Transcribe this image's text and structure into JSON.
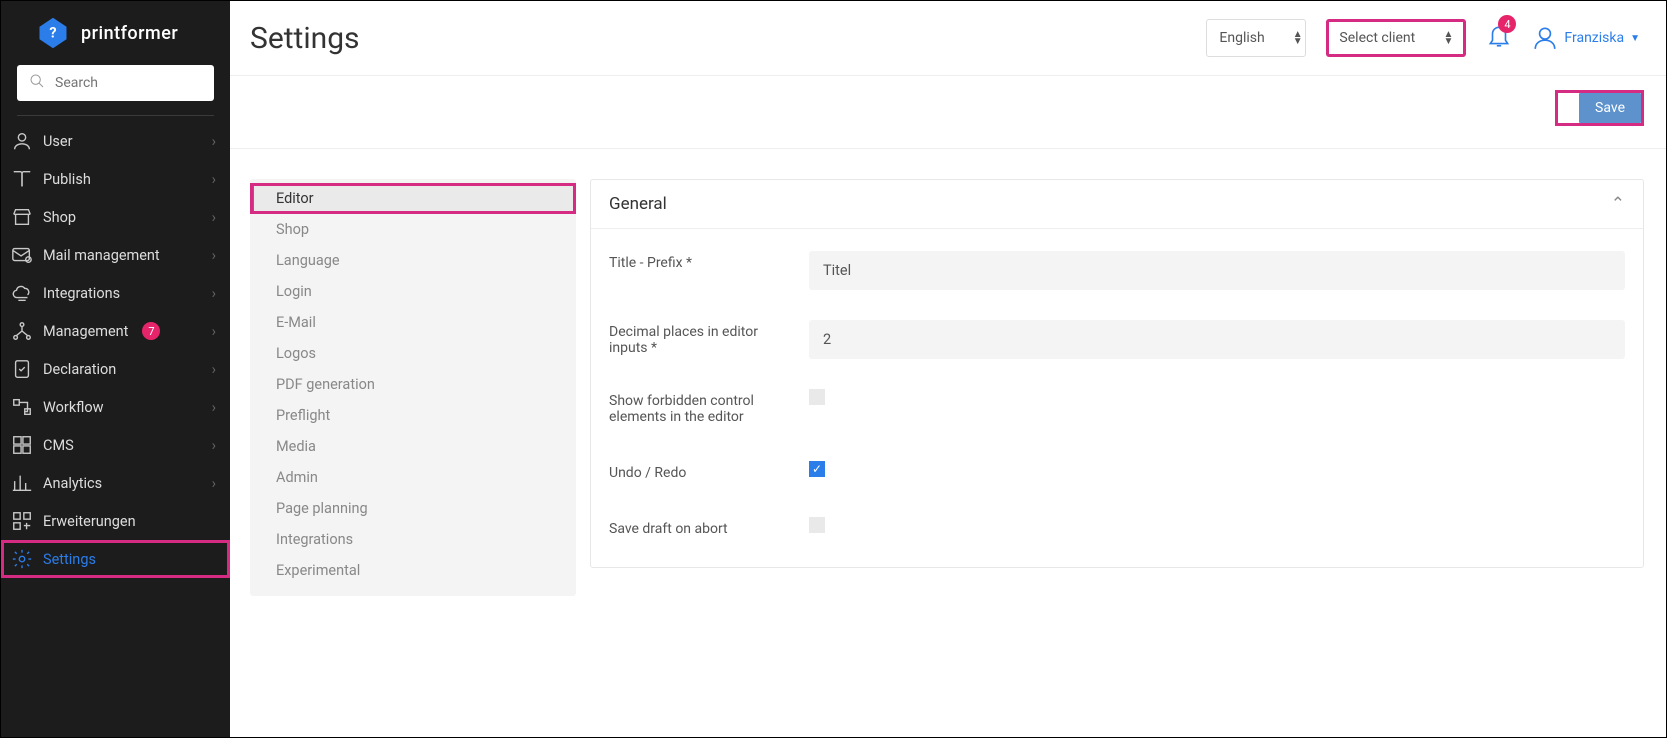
{
  "brand": "printformer",
  "search": {
    "placeholder": "Search"
  },
  "sidebar": {
    "items": [
      {
        "label": "User",
        "badge": null,
        "chevron": true
      },
      {
        "label": "Publish",
        "badge": null,
        "chevron": true
      },
      {
        "label": "Shop",
        "badge": null,
        "chevron": true
      },
      {
        "label": "Mail management",
        "badge": null,
        "chevron": true
      },
      {
        "label": "Integrations",
        "badge": null,
        "chevron": true
      },
      {
        "label": "Management",
        "badge": "7",
        "chevron": true
      },
      {
        "label": "Declaration",
        "badge": null,
        "chevron": true
      },
      {
        "label": "Workflow",
        "badge": null,
        "chevron": true
      },
      {
        "label": "CMS",
        "badge": null,
        "chevron": true
      },
      {
        "label": "Analytics",
        "badge": null,
        "chevron": true
      },
      {
        "label": "Erweiterungen",
        "badge": null,
        "chevron": false
      },
      {
        "label": "Settings",
        "badge": null,
        "chevron": false
      }
    ]
  },
  "header": {
    "title": "Settings",
    "language_select": "English",
    "client_select": "Select client",
    "bell_badge": "4",
    "username": "Franziska"
  },
  "actions": {
    "save": "Save"
  },
  "subnav": {
    "items": [
      {
        "label": "Editor"
      },
      {
        "label": "Shop"
      },
      {
        "label": "Language"
      },
      {
        "label": "Login"
      },
      {
        "label": "E-Mail"
      },
      {
        "label": "Logos"
      },
      {
        "label": "PDF generation"
      },
      {
        "label": "Preflight"
      },
      {
        "label": "Media"
      },
      {
        "label": "Admin"
      },
      {
        "label": "Page planning"
      },
      {
        "label": "Integrations"
      },
      {
        "label": "Experimental"
      }
    ]
  },
  "panel": {
    "title": "General",
    "fields": {
      "title_prefix_label": "Title - Prefix *",
      "title_prefix_value": "Titel",
      "decimal_label": "Decimal places in editor inputs *",
      "decimal_value": "2",
      "forbidden_label": "Show forbidden control elements in the editor",
      "undo_label": "Undo / Redo",
      "draft_label": "Save draft on abort"
    }
  }
}
